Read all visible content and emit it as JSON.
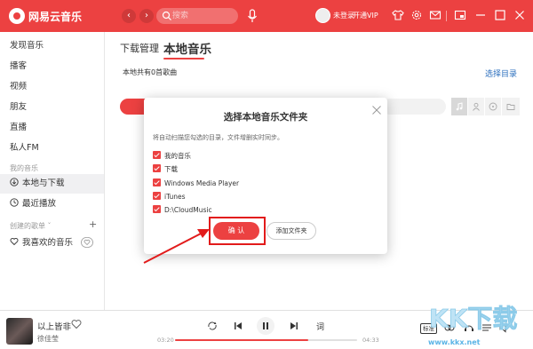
{
  "titlebar": {
    "app_name": "网易云音乐",
    "search_placeholder": "搜索",
    "login": "未登录",
    "vip": "开通VIP",
    "accent": "#ec4141"
  },
  "sidebar": {
    "items": [
      {
        "label": "发现音乐"
      },
      {
        "label": "播客"
      },
      {
        "label": "视频"
      },
      {
        "label": "朋友"
      },
      {
        "label": "直播"
      },
      {
        "label": "私人FM"
      }
    ],
    "my_music_group": "我的音乐",
    "my_items": [
      {
        "label": "本地与下载",
        "icon": "download-icon"
      },
      {
        "label": "最近播放",
        "icon": "clock-icon"
      }
    ],
    "created_group": "创建的歌单",
    "liked": "我喜欢的音乐"
  },
  "main": {
    "tabs": [
      {
        "label": "下载管理"
      },
      {
        "label": "本地音乐"
      }
    ],
    "local_count": "本地共有0首歌曲",
    "choose_dir": "选择目录"
  },
  "dialog": {
    "title": "选择本地音乐文件夹",
    "description": "将自动扫描您勾选的目录，文件增删实时同步。",
    "folders": [
      {
        "label": "我的音乐",
        "checked": true
      },
      {
        "label": "下载",
        "checked": true
      },
      {
        "label": "Windows Media Player",
        "checked": true
      },
      {
        "label": "iTunes",
        "checked": true
      },
      {
        "label": "D:\\CloudMusic",
        "checked": true
      }
    ],
    "confirm": "确 认",
    "add_folder": "添加文件夹"
  },
  "player": {
    "song_title": "以上皆非",
    "artist": "徐佳莹",
    "time_current": "03:20",
    "time_total": "04:33",
    "progress": 0.73,
    "lyric_btn": "词",
    "quality": "标准"
  },
  "watermark": {
    "text": "www.kkx.net"
  }
}
